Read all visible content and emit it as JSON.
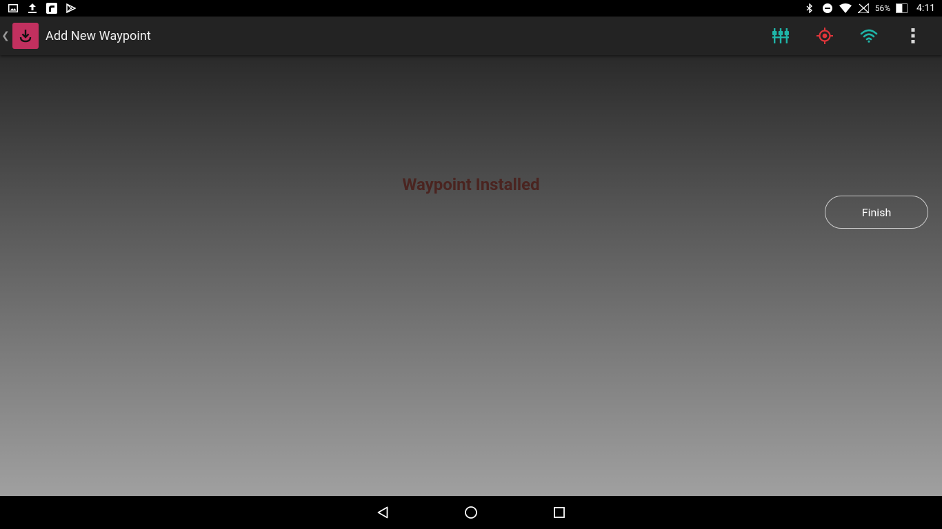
{
  "status_bar": {
    "left_icons": [
      "image-notification-icon",
      "upload-notification-icon",
      "app-notification-icon",
      "play-store-notification-icon"
    ],
    "right_icons": [
      "bluetooth-icon",
      "do-not-disturb-icon",
      "wifi-icon",
      "no-sim-icon"
    ],
    "battery_percent": "56%",
    "battery_level": 0.56,
    "time": "4:11"
  },
  "app_bar": {
    "title": "Add New Waypoint",
    "logo_icon": "anchor-download-icon",
    "logo_color": "#c2305f",
    "actions": [
      {
        "name": "sensors-icon",
        "color": "#1fb5a8"
      },
      {
        "name": "location-target-icon",
        "color": "#e0353a"
      },
      {
        "name": "wifi-signal-icon",
        "color": "#1fb5a8"
      },
      {
        "name": "overflow-menu-icon",
        "color": "#d8d8d8"
      }
    ]
  },
  "main": {
    "status_message": "Waypoint Installed",
    "finish_label": "Finish"
  },
  "nav_bar": {
    "buttons": [
      "back-icon",
      "home-icon",
      "recents-icon"
    ]
  }
}
